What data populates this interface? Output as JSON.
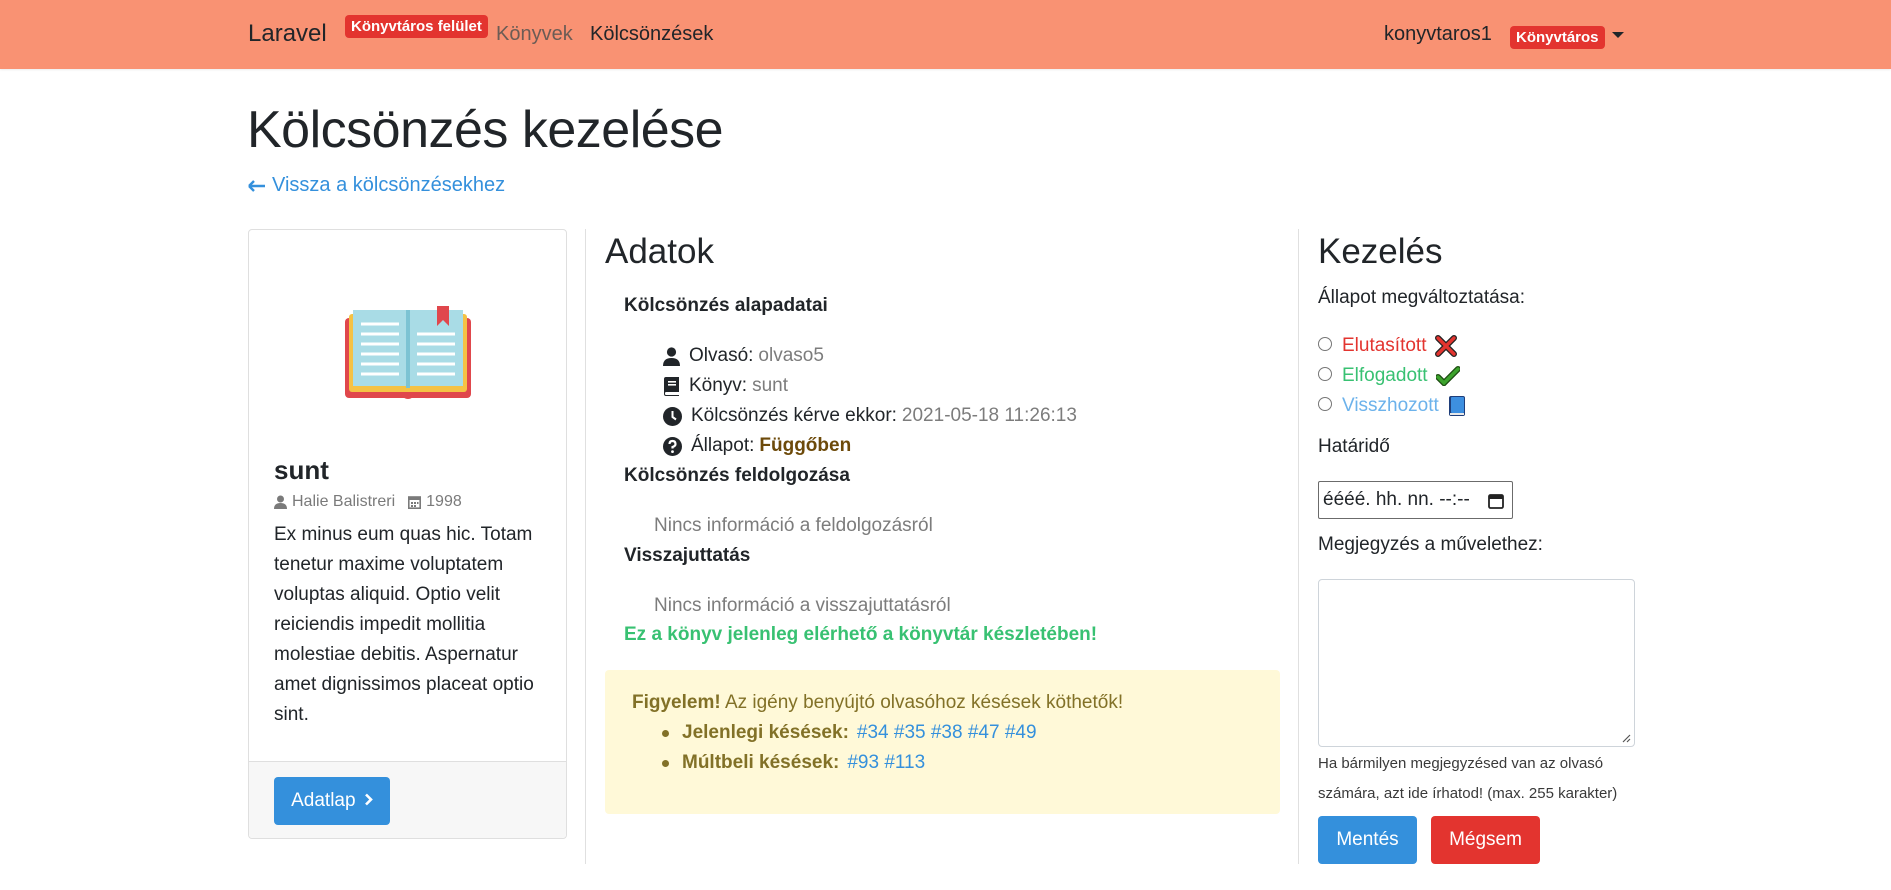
{
  "navbar": {
    "brand": "Laravel",
    "brand_badge": "Könyvtáros felület",
    "nav_books": "Könyvek",
    "nav_loans": "Kölcsönzések",
    "username": "konyvtaros1",
    "role_badge": "Könyvtáros"
  },
  "page": {
    "title": "Kölcsönzés kezelése",
    "back_link": "Vissza a kölcsönzésekhez"
  },
  "book_card": {
    "title": "sunt",
    "author": "Halie Balistreri",
    "year": "1998",
    "description": "Ex minus eum quas hic. Totam tenetur maxime voluptatem voluptas aliquid. Optio velit reiciendis impedit mollitia molestiae debitis. Aspernatur amet dignissimos placeat optio sint.",
    "button_label": "Adatlap"
  },
  "data": {
    "heading": "Adatok",
    "basics_heading": "Kölcsönzés alapadatai",
    "reader_label": "Olvasó:",
    "reader_value": "olvaso5",
    "book_label": "Könyv:",
    "book_value": "sunt",
    "requested_label": "Kölcsönzés kérve ekkor:",
    "requested_value": "2021-05-18 11:26:13",
    "status_label": "Állapot:",
    "status_value": "Függőben",
    "processing_heading": "Kölcsönzés feldolgozása",
    "processing_info": "Nincs információ a feldolgozásról",
    "return_heading": "Visszajuttatás",
    "return_info": "Nincs információ a visszajuttatásról",
    "availability": "Ez a könyv jelenleg elérhető a könyvtár készletében!"
  },
  "alert": {
    "strong": "Figyelem!",
    "text": "Az igény benyújtó olvasóhoz késések köthetők!",
    "current_label": "Jelenlegi késések:",
    "current_links": [
      "#34",
      "#35",
      "#38",
      "#47",
      "#49"
    ],
    "past_label": "Múltbeli késések:",
    "past_links": [
      "#93",
      "#113"
    ]
  },
  "manage": {
    "heading": "Kezelés",
    "change_status_label": "Állapot megváltoztatása:",
    "options": [
      {
        "label": "Elutasított",
        "color": "#e3342f",
        "icon": "red-x-icon"
      },
      {
        "label": "Elfogadott",
        "color": "#38c172",
        "icon": "green-check-icon"
      },
      {
        "label": "Visszhozott",
        "color": "#6cb2eb",
        "icon": "blue-book-icon"
      }
    ],
    "deadline_label": "Határidő",
    "deadline_placeholder": "éééé. hh. nn. --:--",
    "comment_label": "Megjegyzés a művelethez:",
    "help_text": "Ha bármilyen megjegyzésed van az olvasó számára, azt ide írhatod! (max. 255 karakter)",
    "save_label": "Mentés",
    "cancel_label": "Mégsem"
  },
  "colors": {
    "navbar": "#f99273",
    "primary": "#3490dc",
    "danger": "#e3342f",
    "success": "#38c172",
    "alert_bg": "#fff9d8"
  }
}
